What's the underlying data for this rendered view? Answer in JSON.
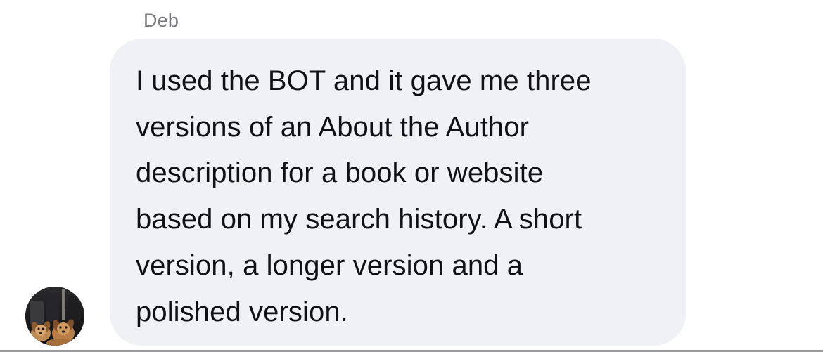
{
  "thread": {
    "sender_name": "Deb",
    "message": {
      "text": "I used the BOT and it gave me three\nversions of an About the Author\ndescription for a book or website\nbased on my search history. A short\nversion, a longer version and a\npolished version."
    },
    "avatar": {
      "icon": "avatar-two-dogs-icon"
    }
  },
  "colors": {
    "bubble_background": "#f0f1f5",
    "message_text": "#111114",
    "sender_name_text": "#7a7a7e",
    "page_background": "#ffffff"
  }
}
